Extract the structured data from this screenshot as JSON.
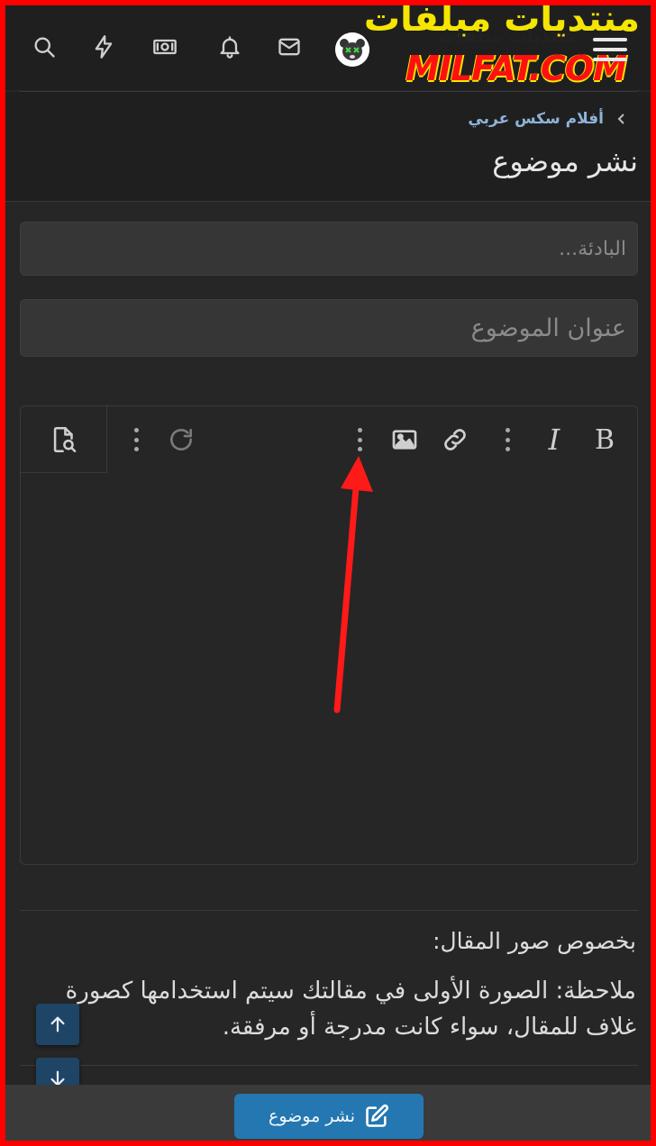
{
  "header": {
    "icons": [
      "search-icon",
      "bolt-icon",
      "money-icon",
      "bell-icon",
      "mail-icon",
      "avatar",
      "hamburger-icon"
    ],
    "logo_arabic": "منتديات ميلفات",
    "logo_arabic_small": "منتديات ميلفات",
    "logo_latin": "MILFAT.COM"
  },
  "breadcrumb": {
    "label": "أفلام سكس عربي"
  },
  "page": {
    "title": "نشر موضوع"
  },
  "form": {
    "prefix_placeholder": "البادئة...",
    "title_placeholder": "عنوان الموضوع"
  },
  "editor": {
    "toolbar": [
      "preview-icon",
      "more-icon",
      "redo-icon",
      "more-icon",
      "image-icon",
      "link-icon",
      "more-icon",
      "italic-icon",
      "bold-icon"
    ],
    "bold_label": "B",
    "italic_label": "I"
  },
  "note": {
    "heading": "بخصوص صور المقال:",
    "body": "ملاحظة: الصورة الأولى في مقالتك سيتم استخدامها كصورة غلاف للمقال، سواء كانت مدرجة أو مرفقة."
  },
  "footer": {
    "submit_label": "نشر موضوع"
  },
  "colors": {
    "accent": "#2577b1",
    "frame": "#ff0000",
    "logo_yellow": "#f4e600",
    "annotation_arrow": "#ff1a1a"
  }
}
